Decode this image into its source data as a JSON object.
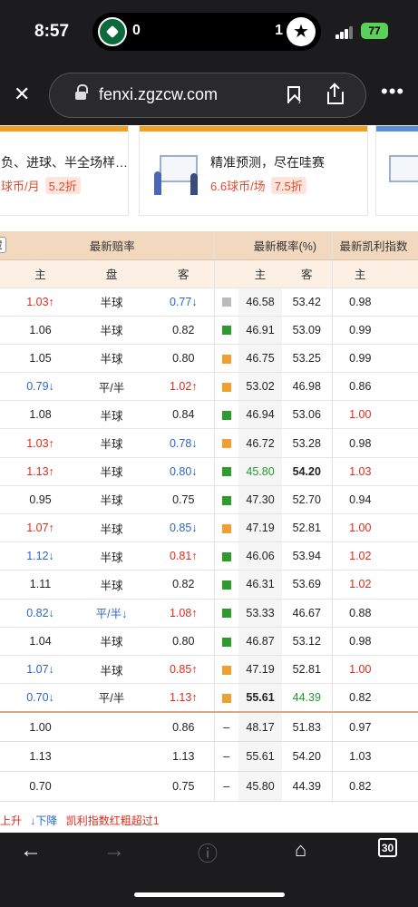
{
  "status": {
    "time": "8:57",
    "score_home": "0",
    "score_away": "1",
    "battery": "77"
  },
  "browser": {
    "url": "fenxi.zgzcw.com",
    "tab_count": "30"
  },
  "banners": [
    {
      "text": "负、进球、半全场样…",
      "price": "球币/月",
      "discount": "5.2折",
      "accent": "#f0a020"
    },
    {
      "text": "精准预测，尽在哇赛",
      "price": "6.6球币/场",
      "discount": "7.5折",
      "accent": "#f0a020"
    }
  ],
  "table": {
    "hide_label": "藏",
    "group_headers": [
      "最新赔率",
      "最新概率(%)",
      "最新凯利指数"
    ],
    "sub_headers": [
      "主",
      "盘",
      "客",
      "主",
      "客",
      "主"
    ],
    "rows": [
      {
        "h": "1.03",
        "ht": "up",
        "p": "半球",
        "a": "0.77",
        "at": "dn",
        "c": "#bbbbbb",
        "ph": "46.58",
        "pa": "53.42",
        "k": "0.98",
        "kt": ""
      },
      {
        "h": "1.06",
        "ht": "",
        "p": "半球",
        "a": "0.82",
        "at": "",
        "c": "#2e9b2e",
        "ph": "46.91",
        "pa": "53.09",
        "k": "0.99",
        "kt": ""
      },
      {
        "h": "1.05",
        "ht": "",
        "p": "半球",
        "a": "0.80",
        "at": "",
        "c": "#f0a030",
        "ph": "46.75",
        "pa": "53.25",
        "k": "0.99",
        "kt": ""
      },
      {
        "h": "0.79",
        "ht": "dn",
        "p": "平/半",
        "a": "1.02",
        "at": "up",
        "c": "#f0a030",
        "ph": "53.02",
        "pa": "46.98",
        "k": "0.86",
        "kt": ""
      },
      {
        "h": "1.08",
        "ht": "",
        "p": "半球",
        "a": "0.84",
        "at": "",
        "c": "#2e9b2e",
        "ph": "46.94",
        "pa": "53.06",
        "k": "1.00",
        "kt": "up"
      },
      {
        "h": "1.03",
        "ht": "up",
        "p": "半球",
        "a": "0.78",
        "at": "dn",
        "c": "#f0a030",
        "ph": "46.72",
        "pa": "53.28",
        "k": "0.98",
        "kt": ""
      },
      {
        "h": "1.13",
        "ht": "up",
        "p": "半球",
        "a": "0.80",
        "at": "dn",
        "c": "#2e9b2e",
        "ph": "45.80",
        "pa": "54.20",
        "k": "1.03",
        "kt": "up",
        "phs": "green",
        "pas": "bold"
      },
      {
        "h": "0.95",
        "ht": "",
        "p": "半球",
        "a": "0.75",
        "at": "",
        "c": "#2e9b2e",
        "ph": "47.30",
        "pa": "52.70",
        "k": "0.94",
        "kt": ""
      },
      {
        "h": "1.07",
        "ht": "up",
        "p": "半球",
        "a": "0.85",
        "at": "dn",
        "c": "#f0a030",
        "ph": "47.19",
        "pa": "52.81",
        "k": "1.00",
        "kt": "up"
      },
      {
        "h": "1.12",
        "ht": "dn",
        "p": "半球",
        "a": "0.81",
        "at": "up",
        "c": "#2e9b2e",
        "ph": "46.06",
        "pa": "53.94",
        "k": "1.02",
        "kt": "up"
      },
      {
        "h": "1.11",
        "ht": "",
        "p": "半球",
        "a": "0.82",
        "at": "",
        "c": "#2e9b2e",
        "ph": "46.31",
        "pa": "53.69",
        "k": "1.02",
        "kt": "up"
      },
      {
        "h": "0.82",
        "ht": "dn",
        "p": "平/半",
        "pt": "dn",
        "a": "1.08",
        "at": "up",
        "c": "#2e9b2e",
        "ph": "53.33",
        "pa": "46.67",
        "k": "0.88",
        "kt": ""
      },
      {
        "h": "1.04",
        "ht": "",
        "p": "半球",
        "a": "0.80",
        "at": "",
        "c": "#2e9b2e",
        "ph": "46.87",
        "pa": "53.12",
        "k": "0.98",
        "kt": ""
      },
      {
        "h": "1.07",
        "ht": "dn",
        "p": "半球",
        "a": "0.85",
        "at": "up",
        "c": "#f0a030",
        "ph": "47.19",
        "pa": "52.81",
        "k": "1.00",
        "kt": "up"
      },
      {
        "h": "0.70",
        "ht": "dn",
        "p": "平/半",
        "a": "1.13",
        "at": "up",
        "c": "#f0a030",
        "ph": "55.61",
        "pa": "44.39",
        "k": "0.82",
        "kt": "",
        "phs": "bold",
        "pas": "green"
      }
    ],
    "summary": [
      {
        "h": "1.00",
        "a": "0.86",
        "d": "–",
        "ph": "48.17",
        "pa": "51.83",
        "k": "0.97"
      },
      {
        "h": "1.13",
        "a": "1.13",
        "d": "–",
        "ph": "55.61",
        "pa": "54.20",
        "k": "1.03"
      },
      {
        "h": "0.70",
        "a": "0.75",
        "d": "–",
        "ph": "45.80",
        "pa": "44.39",
        "k": "0.82"
      }
    ]
  },
  "legend": {
    "up": "上升",
    "down": "↓下降",
    "kelly": "凯利指数红粗超过1"
  },
  "arrows": {
    "up": "↑",
    "dn": "↓"
  }
}
